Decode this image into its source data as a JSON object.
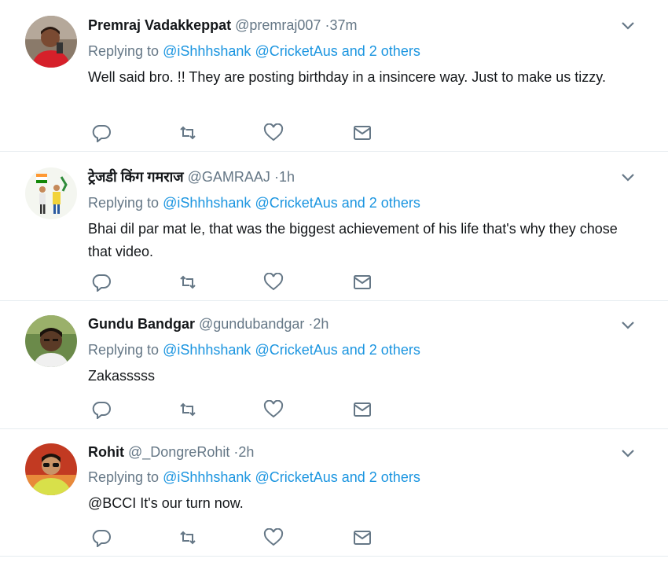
{
  "tweets": [
    {
      "name": "Premraj Vadakkeppat",
      "handle": "@premraj007",
      "time": "37m",
      "replying_prefix": "Replying to",
      "mention1": "@iShhhshank",
      "mention2": "@CricketAus",
      "and_others": "and 2 others",
      "text": "Well said bro. !! They are posting birthday in a insincere way. Just to make us tizzy."
    },
    {
      "name": "ट्रेजडी किंग गमराज",
      "handle": "@GAMRAAJ",
      "time": "1h",
      "replying_prefix": "Replying to",
      "mention1": "@iShhhshank",
      "mention2": "@CricketAus",
      "and_others": "and 2 others",
      "text": "Bhai dil par mat le, that was the biggest achievement of his life that's why they chose that video."
    },
    {
      "name": "Gundu Bandgar",
      "handle": "@gundubandgar",
      "time": "2h",
      "replying_prefix": "Replying to",
      "mention1": "@iShhhshank",
      "mention2": "@CricketAus",
      "and_others": "and 2 others",
      "text": "Zakasssss"
    },
    {
      "name": "Rohit",
      "handle": "@_DongreRohit",
      "time": "2h",
      "replying_prefix": "Replying to",
      "mention1": "@iShhhshank",
      "mention2": "@CricketAus",
      "and_others": "and 2 others",
      "text": "@BCCI  It's our turn now."
    }
  ],
  "icons": {
    "reply": "reply-icon",
    "retweet": "retweet-icon",
    "like": "heart-icon",
    "dm": "envelope-icon",
    "menu": "chevron-down-icon"
  },
  "colors": {
    "link": "#1b95e0",
    "muted": "#657786",
    "text": "#14171a",
    "divider": "#e6ecf0"
  }
}
